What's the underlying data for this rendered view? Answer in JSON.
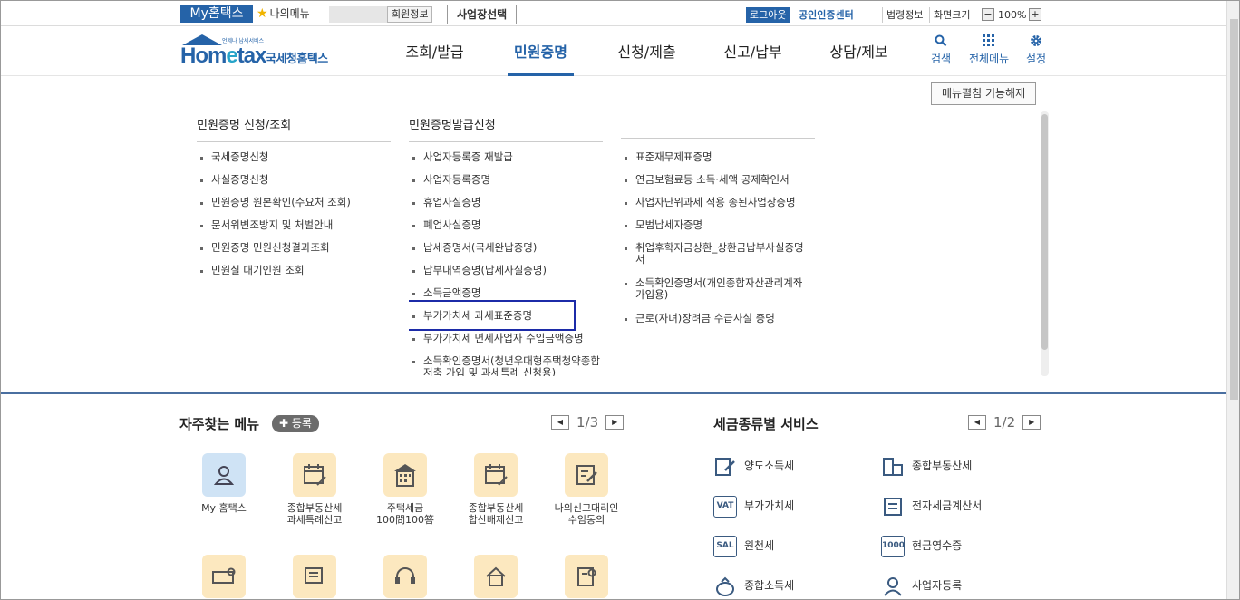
{
  "topbar": {
    "my_hometax": "My홈택스",
    "my_menu": "나의메뉴",
    "member_info": "회원정보",
    "biz_select": "사업장선택",
    "logout": "로그아웃",
    "cert_center": "공인인증센터",
    "law_info": "법령정보",
    "screen_size": "화면크기",
    "zoom": "100%",
    "zoom_minus": "−",
    "zoom_plus": "+"
  },
  "header": {
    "logo_main": "Hom",
    "logo_e": "e",
    "logo_tail": "tax",
    "logo_tagline": "언제나 납세서비스",
    "logo_org": "국세청홈택스",
    "nav": [
      "조회/발급",
      "민원증명",
      "신청/제출",
      "신고/납부",
      "상담/제보"
    ],
    "active_nav": "민원증명",
    "search": "검색",
    "all_menu": "전체메뉴",
    "settings": "설정"
  },
  "mega": {
    "unfold_button": "메뉴펼침 기능해제",
    "col1": {
      "title": "민원증명 신청/조회",
      "items": [
        "국세증명신청",
        "사실증명신청",
        "민원증명 원본확인(수요처 조회)",
        "문서위변조방지 및 처벌안내",
        "민원증명 민원신청결과조회",
        "민원실 대기인원 조회"
      ]
    },
    "col2": {
      "title": "민원증명발급신청",
      "items": [
        "사업자등록증 재발급",
        "사업자등록증명",
        "휴업사실증명",
        "폐업사실증명",
        "납세증명서(국세완납증명)",
        "납부내역증명(납세사실증명)",
        "소득금액증명",
        "부가가치세 과세표준증명",
        "부가가치세 면세사업자 수입금액증명",
        "소득확인증명서(청년우대형주택청약종합저축 가입 및 과세특례 신청용)"
      ]
    },
    "col3": {
      "items": [
        "표준재무제표증명",
        "연금보험료등 소득·세액 공제확인서",
        "사업자단위과세 적용 종된사업장증명",
        "모범납세자증명",
        "취업후학자금상환_상환금납부사실증명서",
        "소득확인증명서(개인종합자산관리계좌 가입용)",
        "근로(자녀)장려금 수급사실 증명"
      ]
    }
  },
  "favorites": {
    "title": "자주찾는 메뉴",
    "register": "등록",
    "page": "1/3",
    "items": [
      {
        "label": "My 홈택스",
        "icon": "person-icon"
      },
      {
        "label": "종합부동산세\n과세특례신고",
        "icon": "calendar-icon"
      },
      {
        "label": "주택세금\n100問100答",
        "icon": "building-icon"
      },
      {
        "label": "종합부동산세\n합산배제신고",
        "icon": "calendar-icon"
      },
      {
        "label": "나의신고대리인\n수임동의",
        "icon": "document-edit-icon"
      }
    ],
    "row2_icons": [
      "receipt-icon",
      "printer-icon",
      "headset-icon",
      "house-icon",
      "certificate-icon"
    ]
  },
  "tax_services": {
    "title": "세금종류별 서비스",
    "page": "1/2",
    "items": [
      {
        "label": "양도소득세",
        "icon": "document-pen-icon"
      },
      {
        "label": "종합부동산세",
        "icon": "buildings-icon"
      },
      {
        "label": "부가가치세",
        "icon": "vat-icon",
        "badge": "VAT"
      },
      {
        "label": "전자세금계산서",
        "icon": "e-invoice-icon"
      },
      {
        "label": "원천세",
        "icon": "salary-icon",
        "badge": "SAL"
      },
      {
        "label": "현금영수증",
        "icon": "cash-receipt-icon",
        "badge": "1000"
      },
      {
        "label": "종합소득세",
        "icon": "money-bag-icon"
      },
      {
        "label": "사업자등록",
        "icon": "business-person-icon"
      }
    ]
  }
}
